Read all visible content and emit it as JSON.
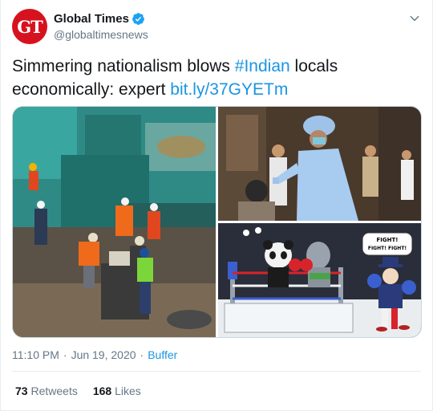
{
  "author": {
    "avatar_text": "GT",
    "name": "Global Times",
    "handle": "@globaltimesnews"
  },
  "tweet": {
    "text_before": "Simmering nationalism blows ",
    "hashtag": "#Indian",
    "text_middle": " locals economically: expert ",
    "link": "bit.ly/37GYETm"
  },
  "media": {
    "cartoon_bubble_line1": "FIGHT!",
    "cartoon_bubble_line2": "FIGHT! FIGHT!"
  },
  "meta": {
    "time": "11:10 PM",
    "separator1": "·",
    "date": "Jun 19, 2020",
    "separator2": "·",
    "source": "Buffer"
  },
  "stats": {
    "retweets_count": "73",
    "retweets_label": "Retweets",
    "likes_count": "168",
    "likes_label": "Likes"
  },
  "colors": {
    "link": "#1b95e0",
    "avatar": "#d7121f",
    "muted": "#657786"
  }
}
